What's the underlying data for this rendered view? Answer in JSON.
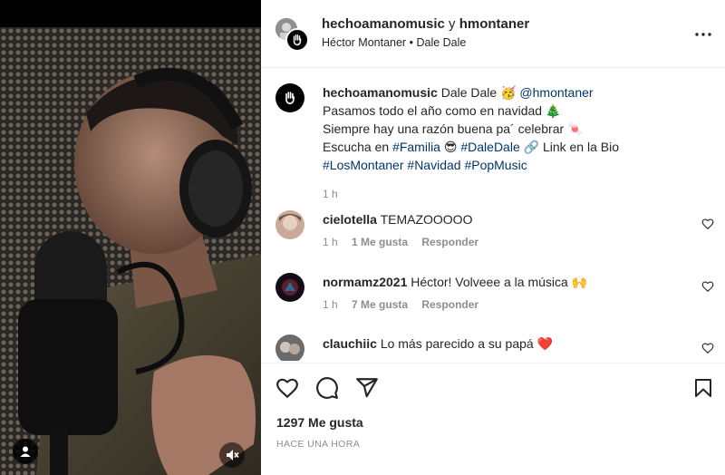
{
  "header": {
    "user_primary": "hechoamanomusic",
    "joiner": "y",
    "user_secondary": "hmontaner",
    "sub_name": "Héctor Montaner",
    "sub_sep": "•",
    "sub_song": "Dale Dale"
  },
  "caption": {
    "username": "hechoamanomusic",
    "line1_text": "Dale Dale 🥳",
    "line1_mention": "@hmontaner",
    "line2": "Pasamos todo el año como en navidad 🎄",
    "line3": "Siempre hay una razón buena pa´ celebrar 🍬",
    "line4_pre": "Escucha en",
    "line4_tag1": "#Familia",
    "line4_emoji": "😎",
    "line4_tag2": "#DaleDale",
    "line4_post": "🔗 Link en la Bio",
    "tag_a": "#LosMontaner",
    "tag_b": "#Navidad",
    "tag_c": "#PopMusic",
    "time": "1 h"
  },
  "comments": [
    {
      "username": "cielotella",
      "text": "TEMAZOOOOO",
      "time": "1 h",
      "likes": "1 Me gusta",
      "reply": "Responder"
    },
    {
      "username": "normamz2021",
      "text": "Héctor! Volveee a la música 🙌",
      "time": "1 h",
      "likes": "7 Me gusta",
      "reply": "Responder"
    },
    {
      "username": "clauchiic",
      "text": "Lo más parecido a su papá ❤️",
      "time": "",
      "likes": "",
      "reply": ""
    }
  ],
  "actions": {
    "likes": "1297 Me gusta",
    "posted": "Hace una hora"
  },
  "icons": {
    "like": "heart-icon",
    "comment": "comment-icon",
    "share": "send-icon",
    "save": "bookmark-icon",
    "more": "more-options-icon",
    "mute": "muted-speaker-icon",
    "user_tag": "person-icon"
  },
  "colors": {
    "link": "#00376b",
    "secondary_text": "#8e8e8e",
    "border": "#efefef"
  }
}
